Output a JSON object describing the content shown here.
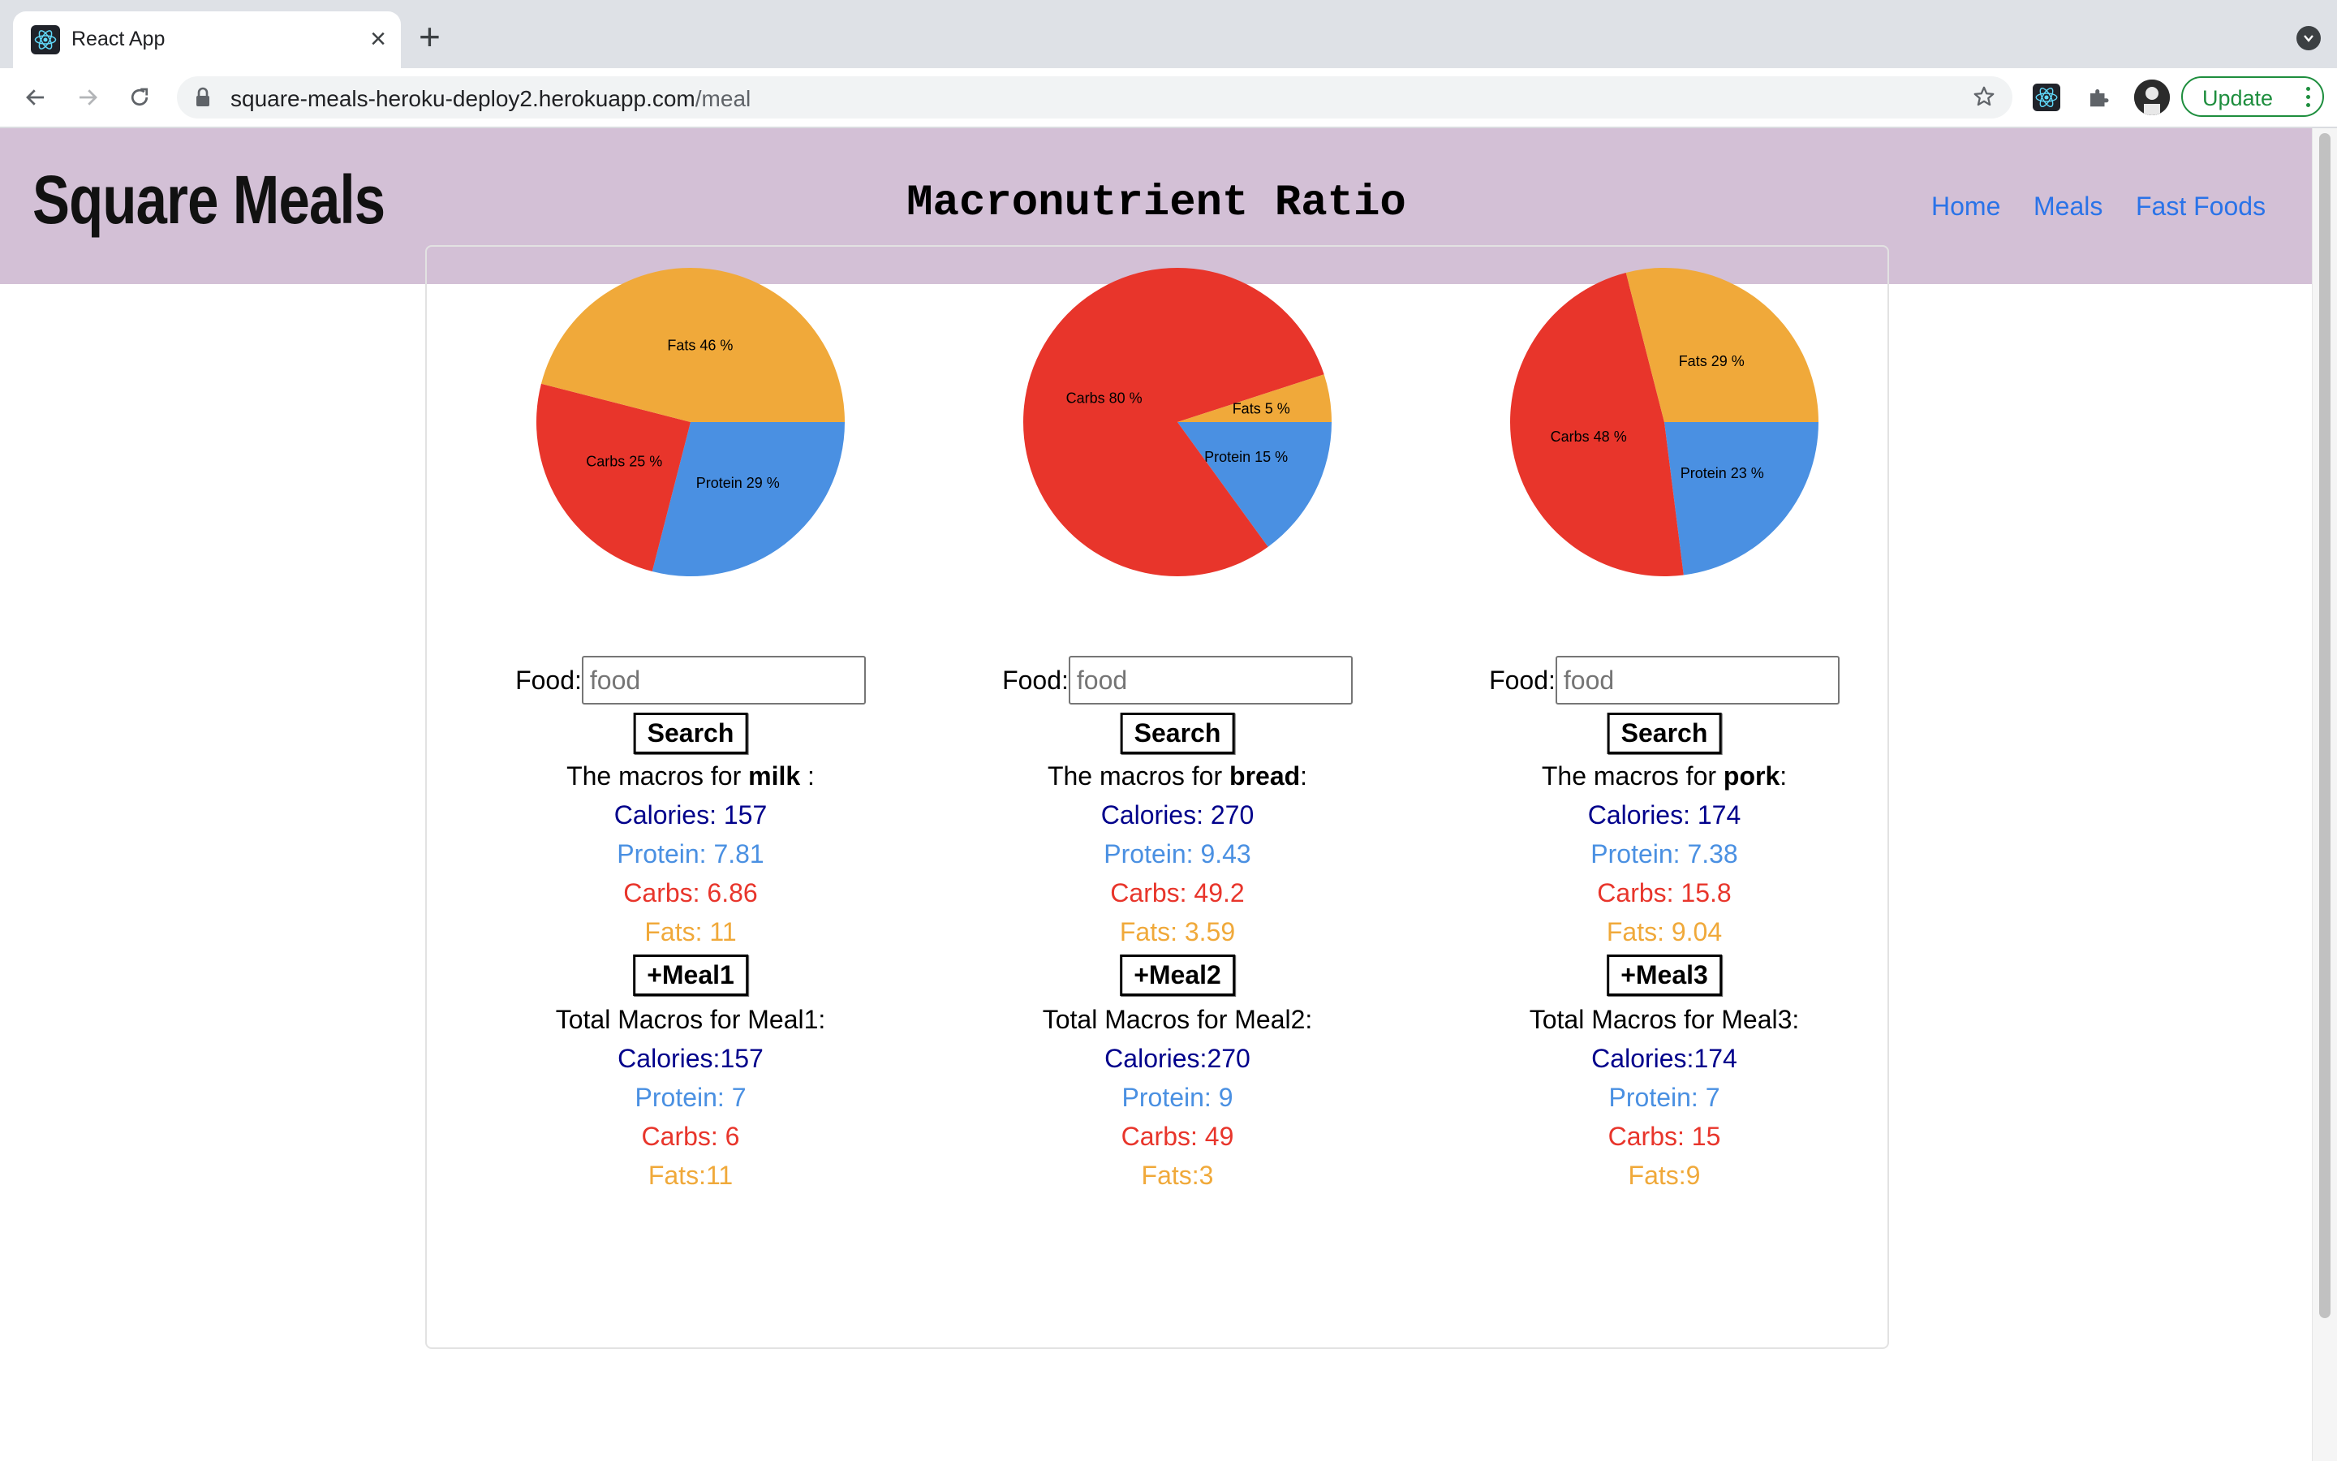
{
  "browser": {
    "tab_title": "React App",
    "url_host": "square-meals-heroku-deploy2.herokuapp.com",
    "url_path": "/meal",
    "update_label": "Update"
  },
  "header": {
    "logo": "Square Meals",
    "nav": [
      "Home",
      "Meals",
      "Fast Foods"
    ]
  },
  "page_title": "Macronutrient Ratio",
  "colors": {
    "protein": "#4a90e2",
    "carbs": "#e8352b",
    "fats": "#f0a93a",
    "calories": "#00008b"
  },
  "columns": [
    {
      "chart": [
        {
          "label": "Protein",
          "percent": 29
        },
        {
          "label": "Carbs",
          "percent": 25
        },
        {
          "label": "Fats",
          "percent": 46
        }
      ],
      "food_label": "Food:",
      "food_placeholder": "food",
      "search_label": "Search",
      "macros_prefix": "The macros for ",
      "food_name": "milk",
      "macros_suffix": " :",
      "calories": "Calories: 157",
      "protein": "Protein: 7.81",
      "carbs": "Carbs: 6.86",
      "fats": "Fats: 11",
      "meal_button": "+Meal1",
      "total_title": "Total Macros for Meal1:",
      "total_calories": "Calories:157",
      "total_protein": "Protein: 7",
      "total_carbs": "Carbs: 6",
      "total_fats": "Fats:11"
    },
    {
      "chart": [
        {
          "label": "Protein",
          "percent": 15
        },
        {
          "label": "Carbs",
          "percent": 80
        },
        {
          "label": "Fats",
          "percent": 5
        }
      ],
      "food_label": "Food:",
      "food_placeholder": "food",
      "search_label": "Search",
      "macros_prefix": "The macros for ",
      "food_name": "bread",
      "macros_suffix": ":",
      "calories": "Calories: 270",
      "protein": "Protein: 9.43",
      "carbs": "Carbs: 49.2",
      "fats": "Fats: 3.59",
      "meal_button": "+Meal2",
      "total_title": "Total Macros for Meal2:",
      "total_calories": "Calories:270",
      "total_protein": "Protein: 9",
      "total_carbs": "Carbs: 49",
      "total_fats": "Fats:3"
    },
    {
      "chart": [
        {
          "label": "Protein",
          "percent": 23
        },
        {
          "label": "Carbs",
          "percent": 48
        },
        {
          "label": "Fats",
          "percent": 29
        }
      ],
      "food_label": "Food:",
      "food_placeholder": "food",
      "search_label": "Search",
      "macros_prefix": "The macros for ",
      "food_name": "pork",
      "macros_suffix": ":",
      "calories": "Calories: 174",
      "protein": "Protein: 7.38",
      "carbs": "Carbs: 15.8",
      "fats": "Fats: 9.04",
      "meal_button": "+Meal3",
      "total_title": "Total Macros for Meal3:",
      "total_calories": "Calories:174",
      "total_protein": "Protein: 7",
      "total_carbs": "Carbs: 15",
      "total_fats": "Fats:9"
    }
  ],
  "chart_data": [
    {
      "type": "pie",
      "categories": [
        "Protein",
        "Carbs",
        "Fats"
      ],
      "values": [
        29,
        25,
        46
      ]
    },
    {
      "type": "pie",
      "categories": [
        "Protein",
        "Carbs",
        "Fats"
      ],
      "values": [
        15,
        80,
        5
      ]
    },
    {
      "type": "pie",
      "categories": [
        "Protein",
        "Carbs",
        "Fats"
      ],
      "values": [
        23,
        48,
        29
      ]
    }
  ]
}
